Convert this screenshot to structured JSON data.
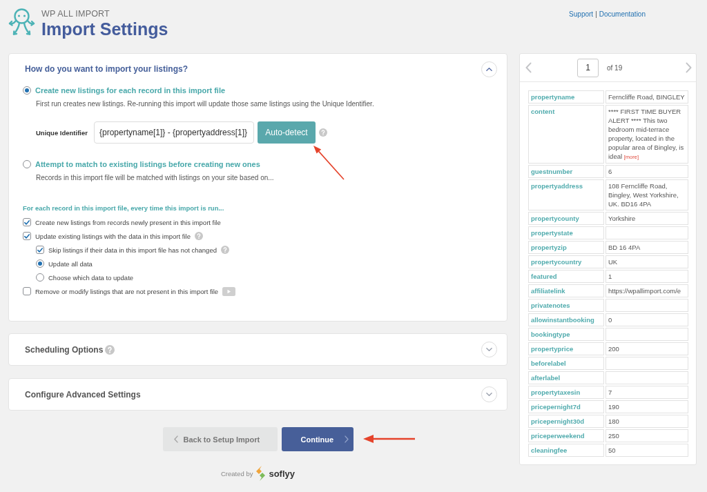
{
  "header": {
    "brand": "WP ALL IMPORT",
    "title": "Import Settings",
    "links": [
      "Support",
      "Documentation"
    ],
    "separator": "|"
  },
  "import_section": {
    "title": "How do you want to import your listings?",
    "expanded": true,
    "options": [
      {
        "label": "Create new listings for each record in this import file",
        "description": "First run creates new listings. Re-running this import will update those same listings using the Unique Identifier.",
        "selected": true,
        "unique_identifier": {
          "label": "Unique Identifier",
          "value": "{propertyname[1]} - {propertyaddress[1]}",
          "button": "Auto-detect",
          "help": true
        }
      },
      {
        "label": "Attempt to match to existing listings before creating new ones",
        "description": "Records in this import file will be matched with listings on your site based on...",
        "selected": false
      }
    ],
    "run_heading": "For each record in this import file, every time this import is run...",
    "settings": [
      {
        "kind": "checkbox",
        "label": "Create new listings from records newly present in this import file",
        "checked": true
      },
      {
        "kind": "checkbox",
        "label": "Update existing listings with the data in this import file",
        "checked": true,
        "help": true,
        "children": [
          {
            "kind": "checkbox",
            "label": "Skip listings if their data in this import file has not changed",
            "checked": true,
            "help": true
          },
          {
            "kind": "radio",
            "label": "Update all data",
            "selected": true
          },
          {
            "kind": "radio",
            "label": "Choose which data to update",
            "selected": false
          }
        ]
      },
      {
        "kind": "checkbox",
        "label": "Remove or modify listings that are not present in this import file",
        "checked": false,
        "video": true
      }
    ]
  },
  "collapsed_sections": [
    {
      "title": "Scheduling Options",
      "help": true,
      "expanded": false
    },
    {
      "title": "Configure Advanced Settings",
      "expanded": false
    }
  ],
  "actions": {
    "back": "Back to Setup Import",
    "continue": "Continue"
  },
  "footer": {
    "prefix": "Created by",
    "brand": "soflyy"
  },
  "preview": {
    "page": "1",
    "total": "of 19",
    "records": [
      {
        "key": "propertyname",
        "value": "Ferncliffe Road, BINGLEY"
      },
      {
        "key": "content",
        "value": "**** FIRST TIME BUYER ALERT **** This two bedroom mid-terrace property, located in the popular area of Bingley, is ideal",
        "more": "[more]"
      },
      {
        "key": "guestnumber",
        "value": "6"
      },
      {
        "key": "propertyaddress",
        "value": "108 Ferncliffe Road, Bingley, West Yorkshire, UK. BD16 4PA"
      },
      {
        "key": "propertycounty",
        "value": "Yorkshire"
      },
      {
        "key": "propertystate"
      },
      {
        "key": "propertyzip",
        "value": "BD 16 4PA"
      },
      {
        "key": "propertycountry",
        "value": "UK"
      },
      {
        "key": "featured",
        "value": "1"
      },
      {
        "key": "affiliatelink",
        "value": "https://wpallimport.com/e"
      },
      {
        "key": "privatenotes"
      },
      {
        "key": "allowinstantbooking",
        "value": "0"
      },
      {
        "key": "bookingtype"
      },
      {
        "key": "propertyprice",
        "value": "200"
      },
      {
        "key": "beforelabel"
      },
      {
        "key": "afterlabel"
      },
      {
        "key": "propertytaxesin",
        "value": "7"
      },
      {
        "key": "pricepernight7d",
        "value": "190"
      },
      {
        "key": "pricepernight30d",
        "value": "180"
      },
      {
        "key": "priceperweekend",
        "value": "250"
      },
      {
        "key": "cleaningfee",
        "value": "50"
      }
    ]
  }
}
